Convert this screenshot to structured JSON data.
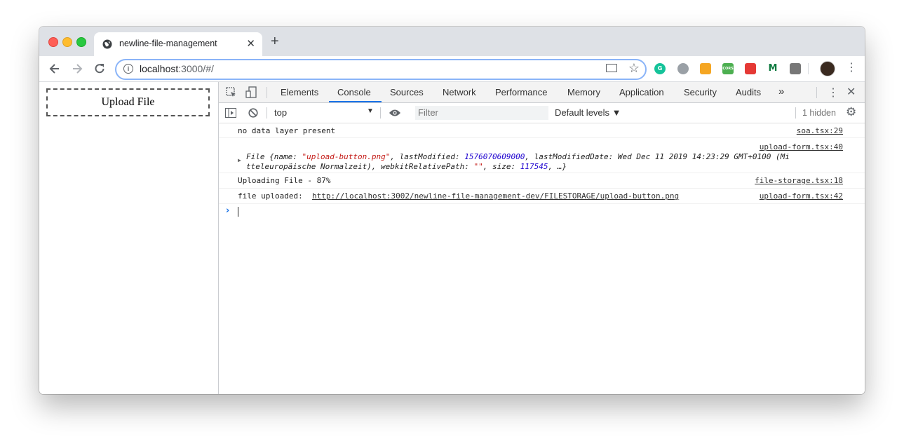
{
  "browser": {
    "tab_title": "newline-file-management",
    "tab_close": "✕",
    "new_tab": "+",
    "url_host": "localhost",
    "url_rest": ":3000/#/",
    "menu": "⋮"
  },
  "extensions": [
    {
      "name": "grammarly-icon",
      "label": "G",
      "color": "#15c39a"
    },
    {
      "name": "circle-extension-icon",
      "label": "",
      "color": "#9aa0a6"
    },
    {
      "name": "orange-extension-icon",
      "label": "",
      "color": "#f5a623"
    },
    {
      "name": "cors-extension-icon",
      "label": "CORS",
      "color": "#4caf50"
    },
    {
      "name": "red-extension-icon",
      "label": "",
      "color": "#e53935"
    },
    {
      "name": "m-extension-icon",
      "label": "M",
      "color": "#0d7a3f"
    },
    {
      "name": "database-extension-icon",
      "label": "",
      "color": "#777777"
    }
  ],
  "page": {
    "upload_button": "Upload File"
  },
  "devtools": {
    "tabs": [
      "Elements",
      "Console",
      "Sources",
      "Network",
      "Performance",
      "Memory",
      "Application",
      "Security",
      "Audits"
    ],
    "active_tab": "Console",
    "more_tabs": "»",
    "context": "top",
    "filter_placeholder": "Filter",
    "levels": "Default levels ▼",
    "hidden": "1 hidden"
  },
  "console": {
    "messages": [
      {
        "text": "no data layer present",
        "source": "soa.tsx:29"
      },
      {
        "source": "upload-form.tsx:40",
        "obj_prefix": "File {name: ",
        "name_value": "\"upload-button.png\"",
        "last_modified_label": ", lastModified: ",
        "last_modified_value": "1576070609000",
        "rest_line1": ", lastModifiedDate: Wed Dec 11 2019 14:23:29 GMT+0100 (Mi",
        "rest_line2_a": "tteleuropäische Normalzeit), webkitRelativePath: ",
        "path_value": "\"\"",
        "size_label": ", size: ",
        "size_value": "117545",
        "rest_end": ", …}"
      },
      {
        "text": "Uploading File - 87%",
        "source": "file-storage.tsx:18"
      },
      {
        "text": "file uploaded:  ",
        "link": "http://localhost:3002/newline-file-management-dev/FILESTORAGE/upload-button.png",
        "source": "upload-form.tsx:42"
      }
    ]
  }
}
